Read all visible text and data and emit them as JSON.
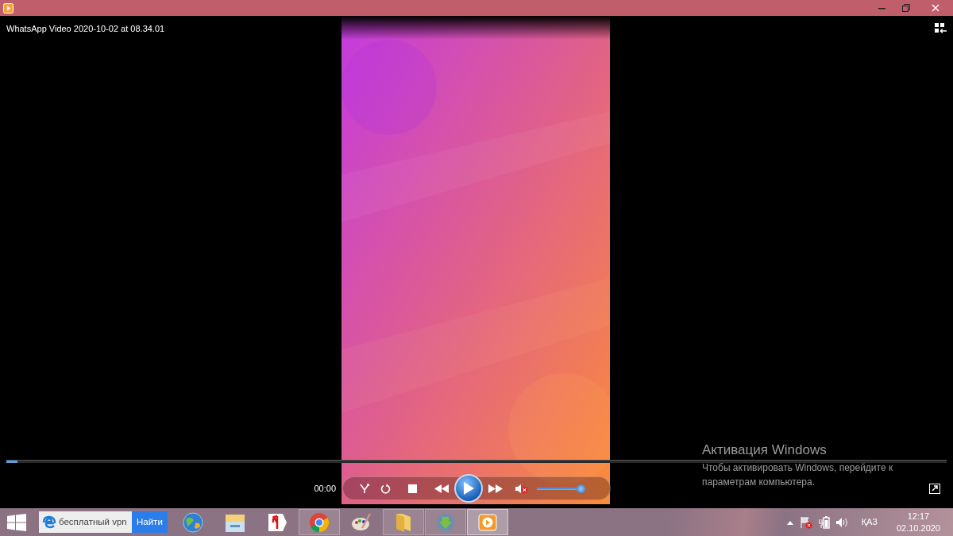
{
  "window": {
    "title": "WhatsApp Video 2020-10-02 at 08.34.01"
  },
  "seek": {
    "level": 0.012
  },
  "player": {
    "elapsed": "00:00",
    "playing": false,
    "muted": true,
    "volume": {
      "level": 0.93
    }
  },
  "activation": {
    "title": "Активация Windows",
    "text": "Чтобы активировать Windows, перейдите к параметрам компьютера."
  },
  "taskbar": {
    "search": {
      "value": "бесплатный vpn",
      "button": "Найти"
    },
    "apps": [
      {
        "kind": "browser-globe",
        "running": false,
        "selected": false
      },
      {
        "kind": "file-cabinet",
        "running": false,
        "selected": false
      },
      {
        "kind": "yandex",
        "running": false,
        "selected": false
      },
      {
        "kind": "chrome",
        "running": true,
        "selected": false
      },
      {
        "kind": "palette",
        "running": false,
        "selected": false
      },
      {
        "kind": "folder",
        "running": true,
        "selected": false
      },
      {
        "kind": "download",
        "running": true,
        "selected": false
      },
      {
        "kind": "media-player",
        "running": true,
        "selected": true
      }
    ],
    "language": "ҚАЗ",
    "time": "12:17",
    "date": "02.10.2020"
  }
}
